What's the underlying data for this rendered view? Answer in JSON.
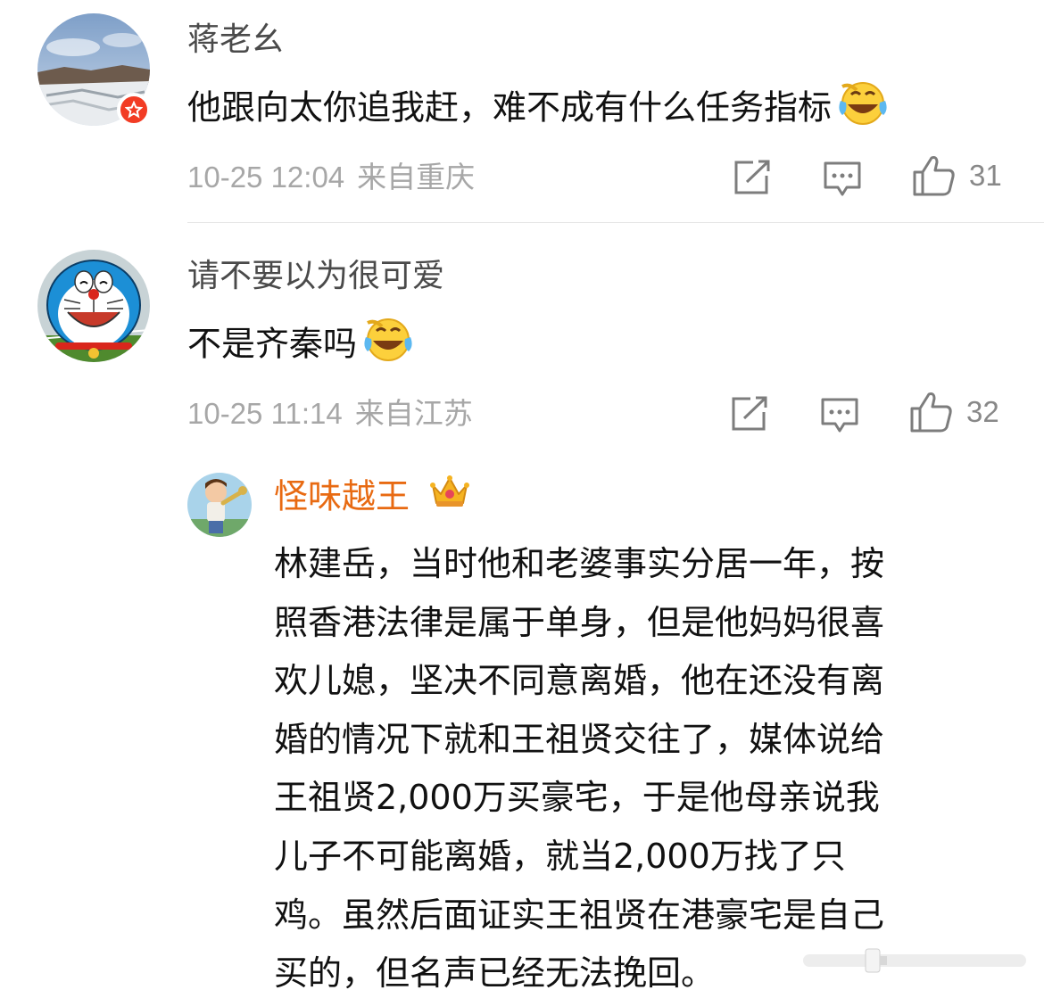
{
  "comments": [
    {
      "username": "蒋老幺",
      "text": "他跟向太你追我赶，难不成有什么任务指标",
      "emoji": "laughing-crying-emoji",
      "date": "10-25 12:04",
      "location": "来自重庆",
      "likes": "31",
      "avatar": "snowy-landscape-avatar",
      "badge": "red-star-badge"
    },
    {
      "username": "请不要以为很可爱",
      "text": "不是齐秦吗",
      "emoji": "laughing-crying-emoji",
      "date": "10-25 11:14",
      "location": "来自江苏",
      "likes": "32",
      "avatar": "doraemon-avatar"
    }
  ],
  "reply": {
    "username": "怪味越王",
    "badge": "crown-icon",
    "avatar": "cartoon-boy-avatar",
    "lines": [
      "林建岳，当时他和老婆事实分居一年，按",
      "照香港法律是属于单身，但是他妈妈很喜",
      "欢儿媳，坚决不同意离婚，他在还没有离",
      "婚的情况下就和王祖贤交往了，媒体说给",
      "王祖贤2,000万买豪宅，于是他母亲说我",
      "儿子不可能离婚，就当2,000万找了只",
      "鸡。虽然后面证实王祖贤在港豪宅是自己",
      "买的，但名声已经无法挽回。"
    ]
  },
  "icons": {
    "share": "share-icon",
    "comment": "comment-icon",
    "like": "like-icon"
  },
  "colors": {
    "username": "#4a4a4a",
    "reply_username": "#e86a12",
    "meta": "#a7a7a7",
    "badge": "#f23c24"
  }
}
